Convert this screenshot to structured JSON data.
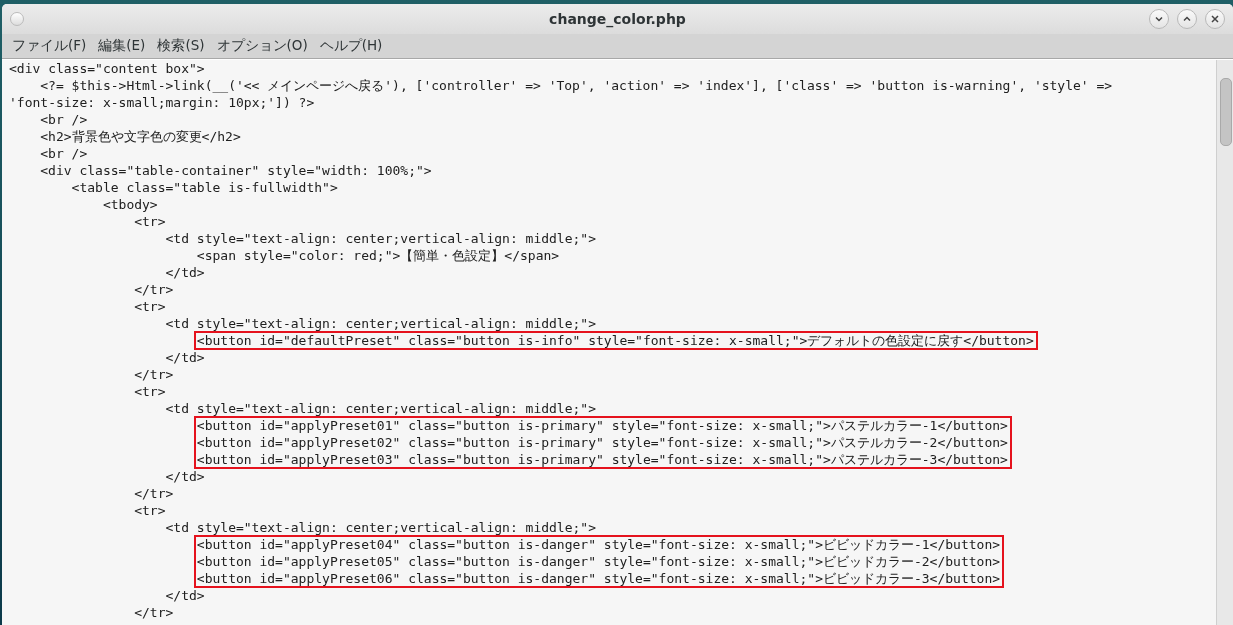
{
  "window": {
    "title": "change_color.php"
  },
  "menu": [
    "ファイル(F)",
    "編集(E)",
    "検索(S)",
    "オプション(O)",
    "ヘルプ(H)"
  ],
  "editor": {
    "lines": [
      {
        "kind": "code",
        "text": "<div class=\"content box\">"
      },
      {
        "kind": "code",
        "text": "    <?= $this->Html->link(__('<< メインページへ戻る'), ['controller' => 'Top', 'action' => 'index'], ['class' => 'button is-warning', 'style' =>"
      },
      {
        "kind": "code",
        "text": "'font-size: x-small;margin: 10px;']) ?>"
      },
      {
        "kind": "code",
        "text": "    <br />"
      },
      {
        "kind": "code",
        "text": "    <h2>背景色や文字色の変更</h2>"
      },
      {
        "kind": "code",
        "text": "    <br />"
      },
      {
        "kind": "code",
        "text": "    <div class=\"table-container\" style=\"width: 100%;\">"
      },
      {
        "kind": "code",
        "text": "        <table class=\"table is-fullwidth\">"
      },
      {
        "kind": "code",
        "text": "            <tbody>"
      },
      {
        "kind": "code",
        "text": "                <tr>"
      },
      {
        "kind": "code",
        "text": "                    <td style=\"text-align: center;vertical-align: middle;\">"
      },
      {
        "kind": "code",
        "text": "                        <span style=\"color: red;\">【簡単・色設定】</span>"
      },
      {
        "kind": "code",
        "text": "                    </td>"
      },
      {
        "kind": "code",
        "text": "                </tr>"
      },
      {
        "kind": "code",
        "text": "                <tr>"
      },
      {
        "kind": "code",
        "text": "                    <td style=\"text-align: center;vertical-align: middle;\">"
      },
      {
        "kind": "highlight",
        "lines": [
          "                        <button id=\"defaultPreset\" class=\"button is-info\" style=\"font-size: x-small;\">デフォルトの色設定に戻す</button>"
        ]
      },
      {
        "kind": "code",
        "text": "                    </td>"
      },
      {
        "kind": "code",
        "text": "                </tr>"
      },
      {
        "kind": "code",
        "text": "                <tr>"
      },
      {
        "kind": "code",
        "text": "                    <td style=\"text-align: center;vertical-align: middle;\">"
      },
      {
        "kind": "highlight",
        "lines": [
          "                        <button id=\"applyPreset01\" class=\"button is-primary\" style=\"font-size: x-small;\">パステルカラー-1</button>",
          "                        <button id=\"applyPreset02\" class=\"button is-primary\" style=\"font-size: x-small;\">パステルカラー-2</button>",
          "                        <button id=\"applyPreset03\" class=\"button is-primary\" style=\"font-size: x-small;\">パステルカラー-3</button>"
        ]
      },
      {
        "kind": "code",
        "text": "                    </td>"
      },
      {
        "kind": "code",
        "text": "                </tr>"
      },
      {
        "kind": "code",
        "text": "                <tr>"
      },
      {
        "kind": "code",
        "text": "                    <td style=\"text-align: center;vertical-align: middle;\">"
      },
      {
        "kind": "highlight",
        "lines": [
          "                        <button id=\"applyPreset04\" class=\"button is-danger\" style=\"font-size: x-small;\">ビビッドカラー-1</button>",
          "                        <button id=\"applyPreset05\" class=\"button is-danger\" style=\"font-size: x-small;\">ビビッドカラー-2</button>",
          "                        <button id=\"applyPreset06\" class=\"button is-danger\" style=\"font-size: x-small;\">ビビッドカラー-3</button>"
        ]
      },
      {
        "kind": "code",
        "text": "                    </td>"
      },
      {
        "kind": "code",
        "text": "                </tr>"
      }
    ]
  }
}
